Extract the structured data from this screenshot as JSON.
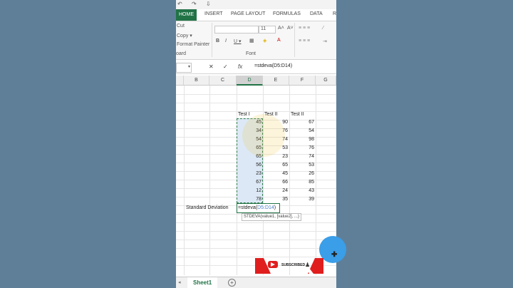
{
  "ribbon": {
    "tabs": [
      "HOME",
      "INSERT",
      "PAGE LAYOUT",
      "FORMULAS",
      "DATA",
      "R"
    ],
    "active_tab": "HOME",
    "clipboard": {
      "cut": "Cut",
      "copy": "Copy ▾",
      "format_painter": "Format Painter",
      "group": "oard"
    },
    "font": {
      "size": "11",
      "group": "Font",
      "bold": "B",
      "italic": "I",
      "underline": "U ▾"
    }
  },
  "formula_bar": {
    "name_box": "",
    "cancel": "✕",
    "enter": "✓",
    "fx": "fx",
    "formula": "=stdeva(D5:D14)"
  },
  "columns": [
    "B",
    "C",
    "D",
    "E",
    "F",
    "G"
  ],
  "table": {
    "headers": [
      "Test I",
      "Test II",
      "Test II"
    ],
    "rows": [
      [
        45,
        90,
        67
      ],
      [
        34,
        76,
        54
      ],
      [
        54,
        74,
        98
      ],
      [
        65,
        53,
        76
      ],
      [
        65,
        23,
        74
      ],
      [
        56,
        65,
        53
      ],
      [
        23,
        45,
        26
      ],
      [
        67,
        66,
        85
      ],
      [
        12,
        24,
        43
      ],
      [
        78,
        35,
        39
      ]
    ]
  },
  "std_dev": {
    "label": "Standard Deviation",
    "formula_start": "=stdeva(",
    "formula_range": "D5:D14",
    "formula_end": ")"
  },
  "tooltip": "STDEVA(value1, [value2], ...)",
  "sheet": {
    "tab": "Sheet1",
    "add": "+"
  },
  "overlay": {
    "subscribe": "SUBSCRIBED",
    "cursor": "✚"
  },
  "colors": {
    "excel_green": "#217346",
    "selection_fill": "#dce8f5",
    "subscribe_red": "#e01e1e",
    "touch_blue": "#3a9ee8"
  }
}
